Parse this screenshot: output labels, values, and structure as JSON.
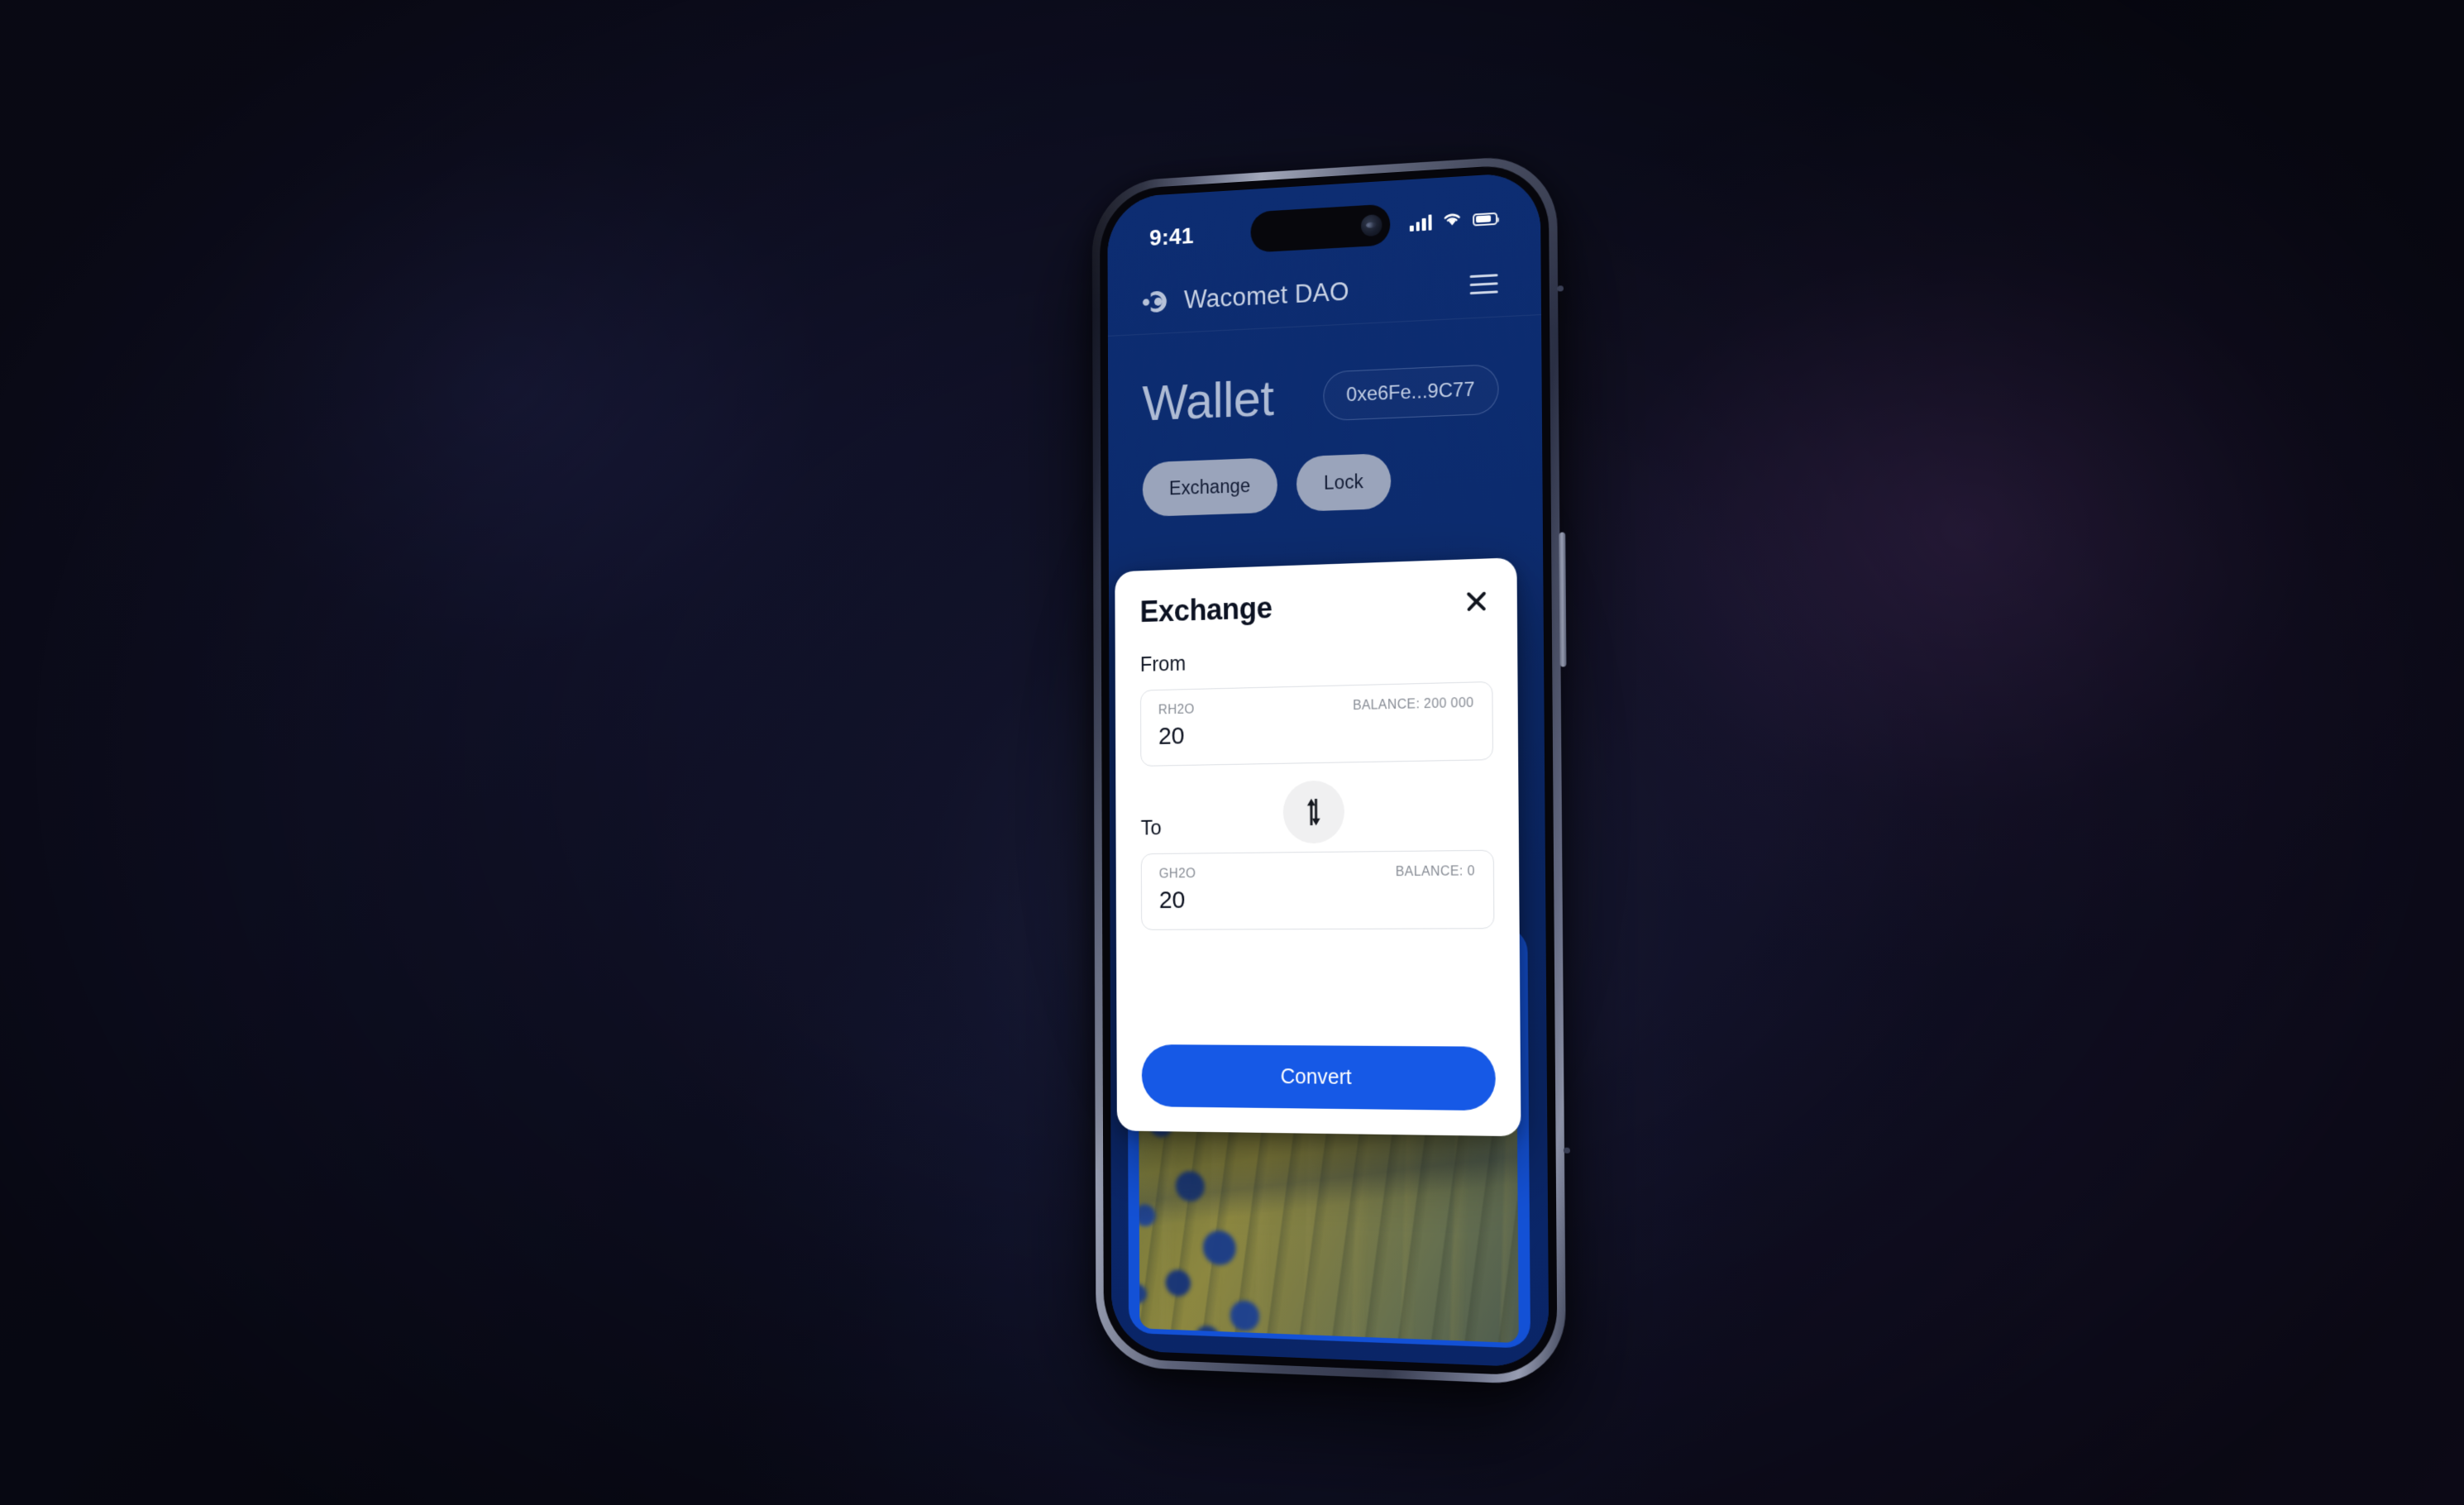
{
  "status_bar": {
    "time": "9:41",
    "signal_icon": "cellular-signal-icon",
    "wifi_icon": "wifi-icon",
    "battery_icon": "battery-icon"
  },
  "app": {
    "brand_name": "Wacomet DAO",
    "logo_icon": "wacomet-logo-icon",
    "menu_icon": "hamburger-menu-icon"
  },
  "wallet": {
    "title": "Wallet",
    "address": "0xe6Fe...9C77",
    "tabs": [
      {
        "label": "Exchange"
      },
      {
        "label": "Lock"
      }
    ]
  },
  "modal": {
    "title": "Exchange",
    "close_icon": "close-icon",
    "from": {
      "label": "From",
      "token": "RH2O",
      "balance": "BALANCE: 200 000",
      "value": "20"
    },
    "swap": {
      "icon": "swap-vertical-icon"
    },
    "to": {
      "label": "To",
      "token": "GH2O",
      "balance": "BALANCE: 0",
      "value": "20"
    },
    "submit_label": "Convert"
  },
  "colors": {
    "app_background": "#0a2769",
    "accent_blue": "#1659e6",
    "tab_pill": "#9aa4bb",
    "modal_background": "#ffffff",
    "page_background": "#0d0e20"
  }
}
